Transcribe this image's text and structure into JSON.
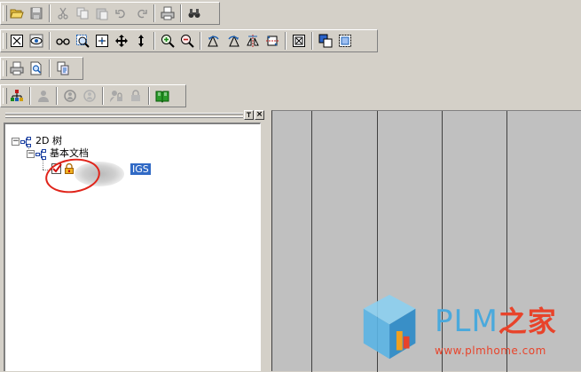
{
  "toolbars": {
    "row1": [
      "open-folder-icon",
      "save-icon",
      "|",
      "cut-icon",
      "copy-icon",
      "paste-icon",
      "undo-icon",
      "redo-icon",
      "|",
      "print-icon",
      "|",
      "binoculars-icon"
    ],
    "row2": [
      "zoom-extents-icon",
      "view-eye-icon",
      "|",
      "glasses-icon",
      "zoom-window-icon",
      "zoom-center-icon",
      "pan-icon",
      "vertical-pan-icon",
      "|",
      "zoom-in-icon",
      "zoom-out-icon",
      "|",
      "rotate-left-icon",
      "rotate-right-icon",
      "mirror-horizontal-icon",
      "mirror-vertical-icon",
      "|",
      "fit-window-icon",
      "|",
      "layers-icon",
      "select-window-icon"
    ],
    "row3": [
      "print-preview-icon",
      "page-search-icon",
      "|",
      "copy-page-icon"
    ],
    "row4": [
      "org-chart-icon",
      "|",
      "user-icon",
      "|",
      "group-rotate-icon",
      "group-rotate-gray-icon",
      "|",
      "user-lock-icon",
      "lock-icon",
      "|",
      "book-icon"
    ]
  },
  "panel": {
    "close_glyph": "×",
    "tree": {
      "root_label": "2D 树",
      "child_label": "基本文档",
      "leaf_label": "IGS",
      "expander_glyph": "−"
    }
  },
  "watermark": {
    "brand_latin": "PLM",
    "brand_cn": "之家",
    "url": "www.plmhome.com"
  },
  "colors": {
    "selection": "#316ac5",
    "annotation_circle": "#e0241a",
    "watermark_blue": "#4aa9dc",
    "watermark_red": "#e8432a"
  }
}
